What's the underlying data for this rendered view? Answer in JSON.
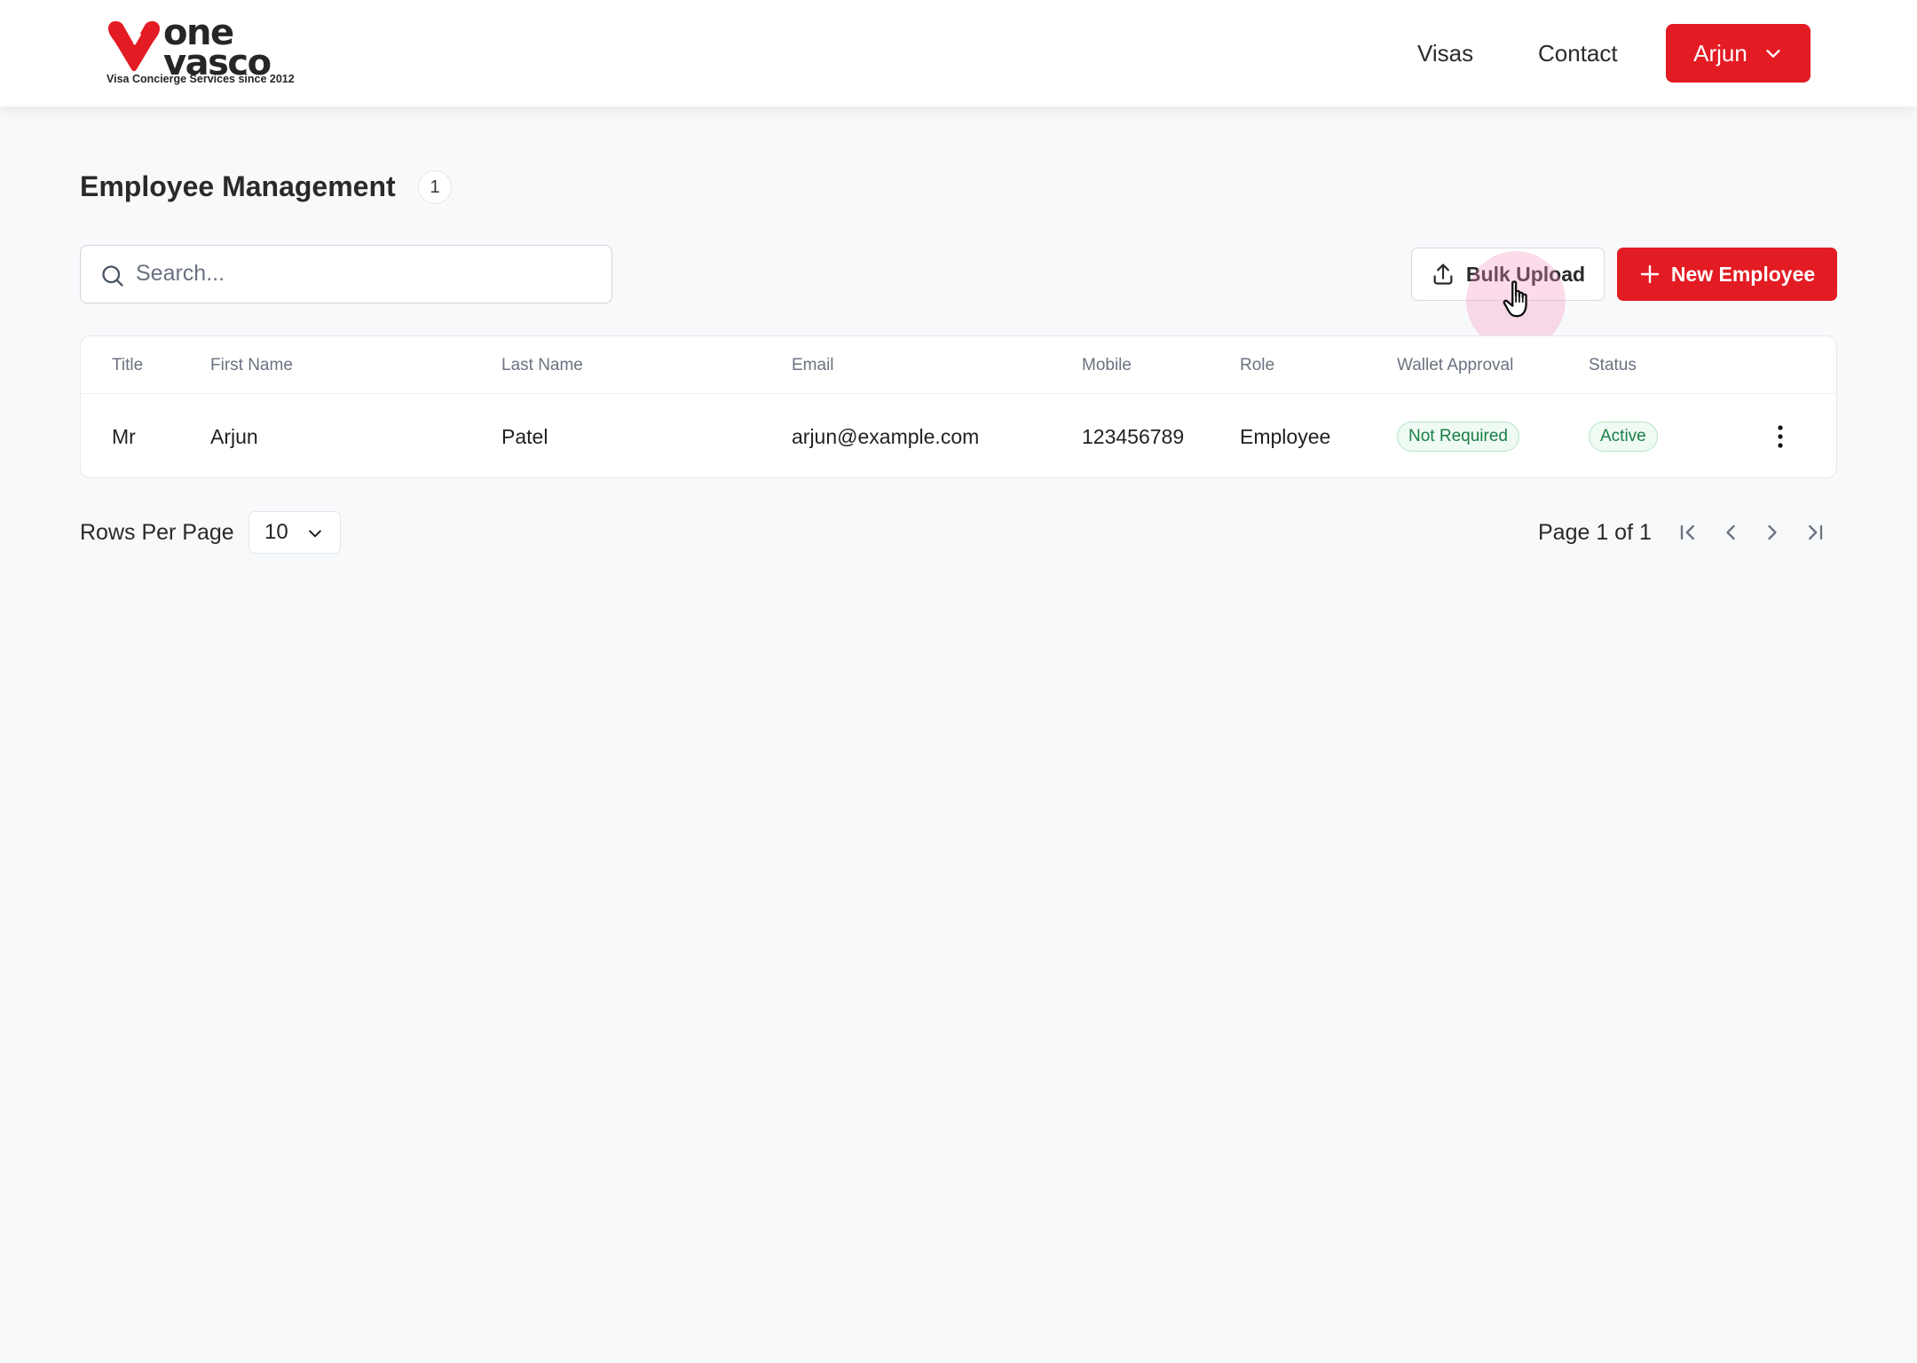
{
  "brand": {
    "logo_line1": "one",
    "logo_line2": "vasco",
    "tagline": "Visa Concierge Services since 2012",
    "accent_color": "#e31b23"
  },
  "nav": {
    "visas_label": "Visas",
    "contact_label": "Contact",
    "user_label": "Arjun"
  },
  "page": {
    "title": "Employee Management",
    "count": "1"
  },
  "search": {
    "placeholder": "Search...",
    "value": ""
  },
  "actions": {
    "bulk_upload_label": "Bulk Upload",
    "new_employee_label": "New Employee"
  },
  "table": {
    "columns": [
      "Title",
      "First Name",
      "Last Name",
      "Email",
      "Mobile",
      "Role",
      "Wallet Approval",
      "Status"
    ],
    "rows": [
      {
        "title": "Mr",
        "first_name": "Arjun",
        "last_name": "Patel",
        "email": "arjun@example.com",
        "mobile": "123456789",
        "role": "Employee",
        "wallet_approval": "Not Required",
        "status": "Active"
      }
    ]
  },
  "pagination": {
    "rows_per_page_label": "Rows Per Page",
    "rows_per_page_value": "10",
    "page_info": "Page 1 of 1"
  },
  "icons": {
    "search": "search-icon",
    "upload": "upload-icon",
    "plus": "plus-icon",
    "chevron": "chevron-down-icon",
    "more": "more-vertical-icon",
    "first": "first-page-icon",
    "prev": "prev-page-icon",
    "next": "next-page-icon",
    "last": "last-page-icon"
  }
}
